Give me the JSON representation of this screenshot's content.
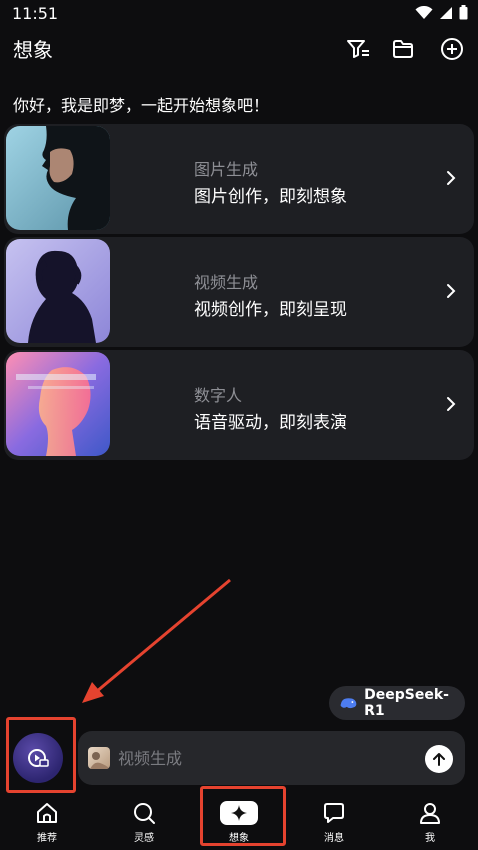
{
  "status": {
    "time": "11:51"
  },
  "header": {
    "title": "想象"
  },
  "greeting": "你好，我是即梦，一起开始想象吧！",
  "cards": [
    {
      "subtitle": "图片生成",
      "title": "图片创作，即刻想象"
    },
    {
      "subtitle": "视频生成",
      "title": "视频创作，即刻呈现"
    },
    {
      "subtitle": "数字人",
      "title": "语音驱动，即刻表演"
    }
  ],
  "model": {
    "label": "DeepSeek-R1"
  },
  "input": {
    "placeholder": "视频生成"
  },
  "tabs": [
    {
      "label": "推荐",
      "icon": "home-icon"
    },
    {
      "label": "灵感",
      "icon": "search-icon"
    },
    {
      "label": "想象",
      "icon": "sparkle-icon"
    },
    {
      "label": "消息",
      "icon": "chat-bubble-icon"
    },
    {
      "label": "我",
      "icon": "person-icon"
    }
  ],
  "colors": {
    "background": "#0d0d0f",
    "card": "#1e1f23",
    "annotation": "#e5432f"
  }
}
